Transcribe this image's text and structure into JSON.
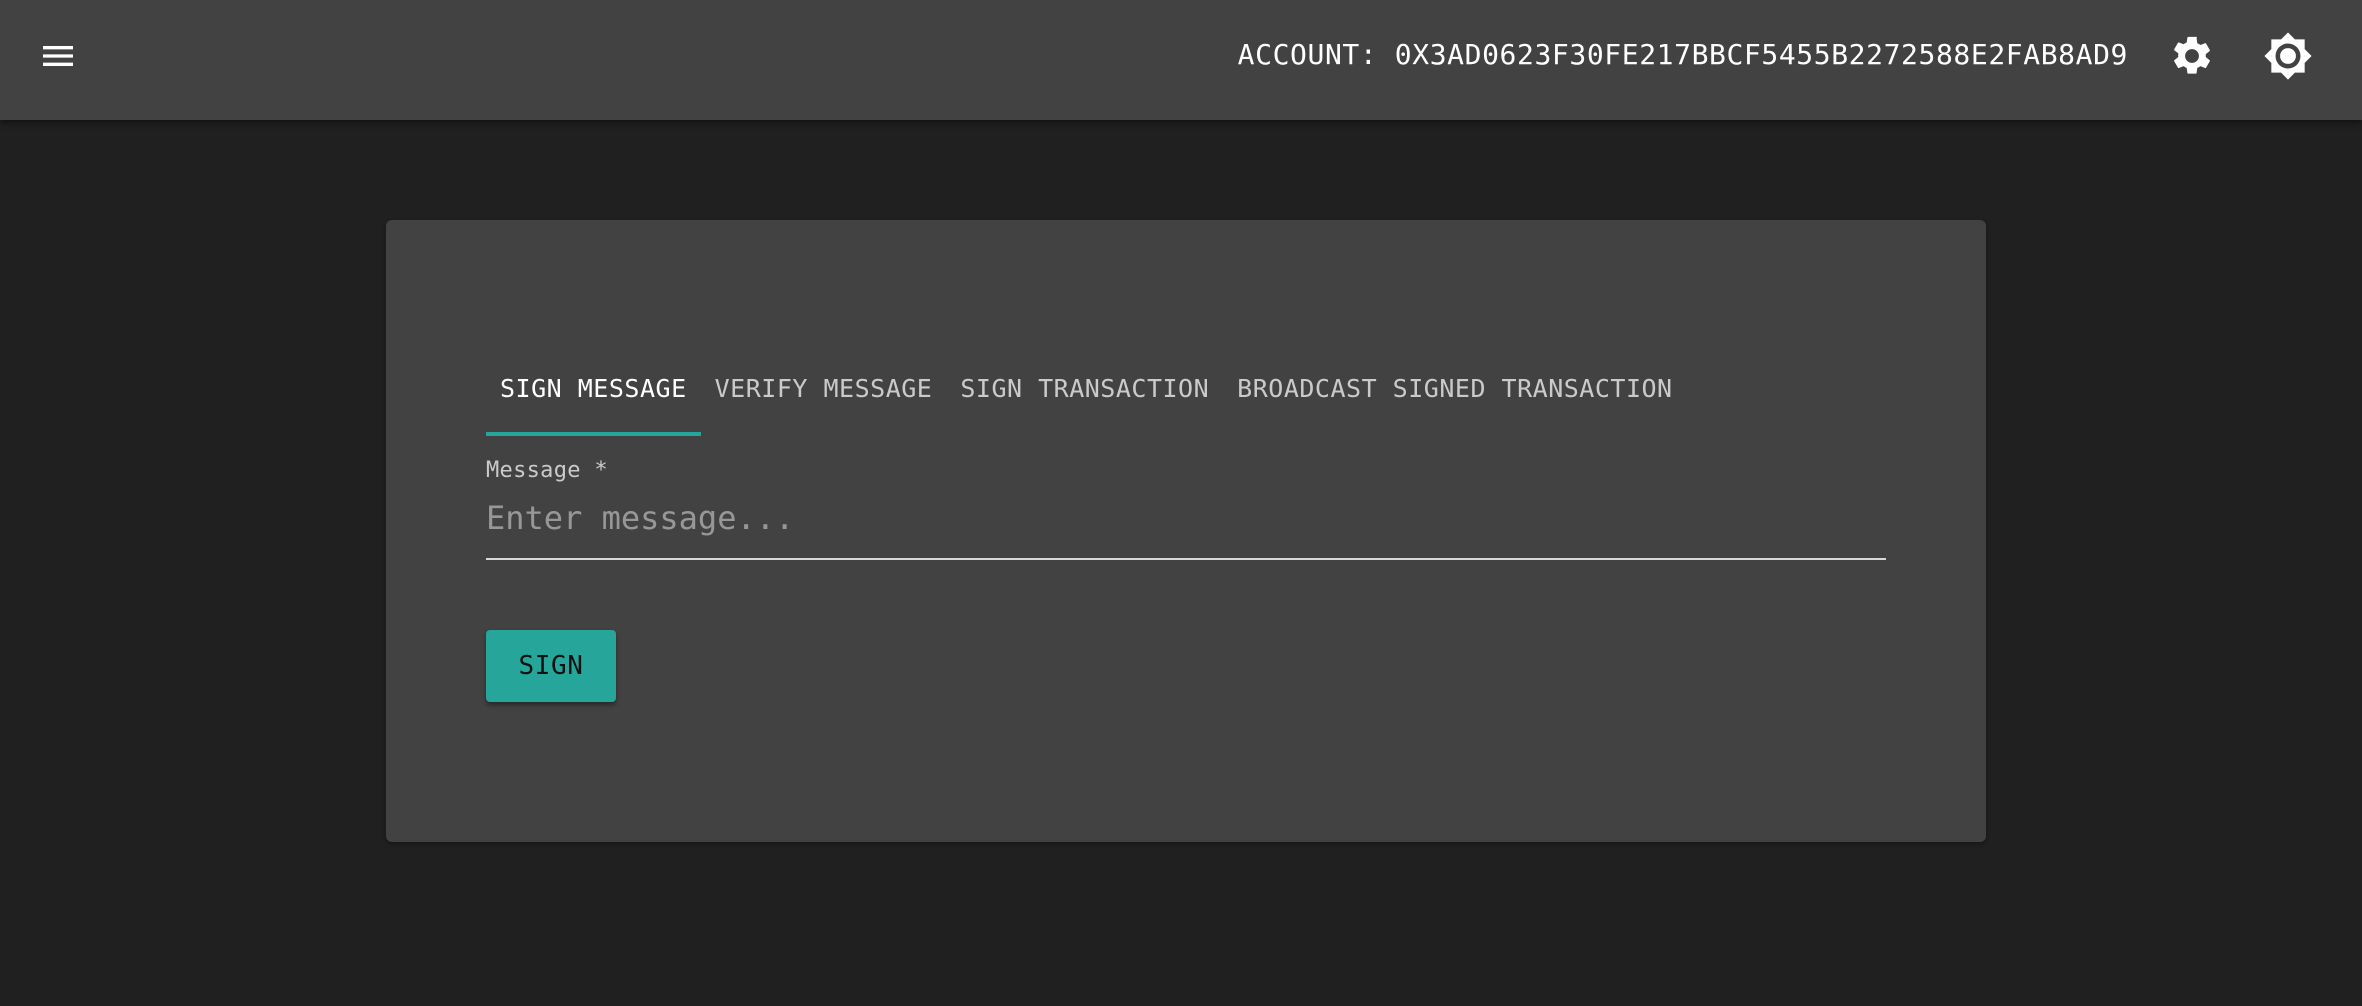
{
  "header": {
    "account_label": "ACCOUNT: 0X3AD0623F30FE217BBCF5455B2272588E2FAB8AD9",
    "icons": [
      "menu-icon",
      "gear-icon",
      "brightness-icon"
    ]
  },
  "tabs": [
    {
      "label": "SIGN MESSAGE",
      "active": true
    },
    {
      "label": "VERIFY MESSAGE",
      "active": false
    },
    {
      "label": "SIGN TRANSACTION",
      "active": false
    },
    {
      "label": "BROADCAST SIGNED TRANSACTION",
      "active": false
    }
  ],
  "form": {
    "message_label": "Message *",
    "message_value": "",
    "message_placeholder": "Enter message...",
    "sign_label": "SIGN"
  },
  "colors": {
    "appbar": "#424242",
    "background": "#202020",
    "card": "#424242",
    "accent": "#26a69a"
  }
}
